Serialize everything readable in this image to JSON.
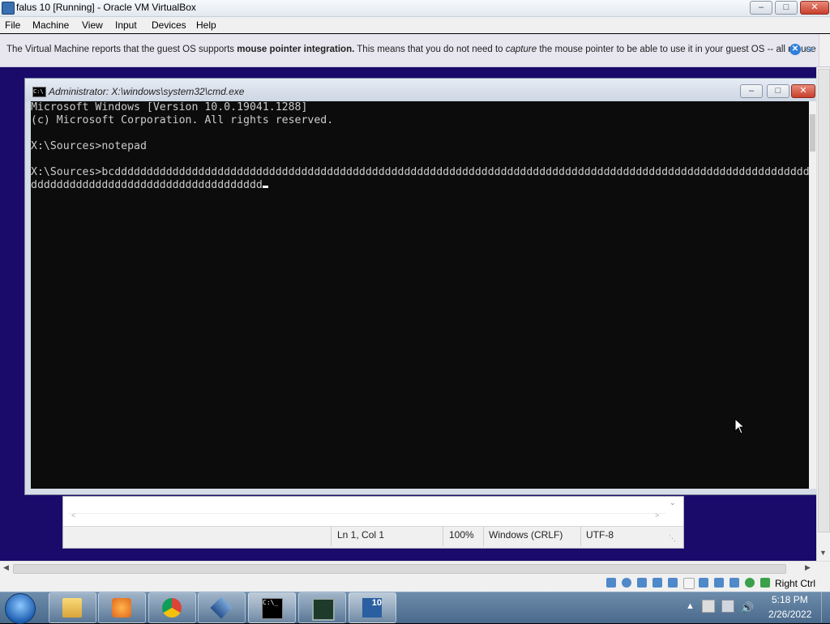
{
  "vbox": {
    "title": "falus 10 [Running] - Oracle VM VirtualBox",
    "menu": [
      "File",
      "Machine",
      "View",
      "Input",
      "Devices",
      "Help"
    ],
    "info_message_pre": "The Virtual Machine reports that the guest OS supports ",
    "info_message_bold": "mouse pointer integration.",
    "info_message_mid": " This means that you do not need to ",
    "info_message_italic": "capture",
    "info_message_post": " the mouse pointer to be able to use it in your guest OS -- all mouse",
    "host_key": "Right Ctrl"
  },
  "cmd": {
    "title": "Administrator: X:\\windows\\system32\\cmd.exe",
    "icon_text": "C:\\",
    "lines": [
      "Microsoft Windows [Version 10.0.19041.1288]",
      "(c) Microsoft Corporation. All rights reserved.",
      "",
      "X:\\Sources>notepad",
      "",
      "X:\\Sources>bcdddddddddddddddddddddddddddddddddddddddddddddddddddddddddddddddddddddddddddddddddddddddddddddddddddddddddddddddddddd",
      "dddddddddddddddddddddddddddddddddddd"
    ]
  },
  "notepad": {
    "status_position": "Ln 1, Col 1",
    "status_zoom": "100%",
    "status_eol": "Windows (CRLF)",
    "status_encoding": "UTF-8"
  },
  "taskbar": {
    "clock_time": "5:18 PM",
    "clock_date": "2/26/2022",
    "apps": [
      "file-explorer",
      "media-player",
      "chrome",
      "virtualbox",
      "command-prompt",
      "task-manager",
      "windows-10-vm"
    ]
  }
}
